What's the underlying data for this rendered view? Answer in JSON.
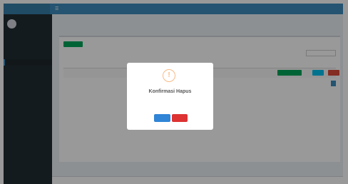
{
  "topbar": {
    "brand": "",
    "toggle_icon": "menu-icon",
    "user": ""
  },
  "sidebar": {
    "user_name": "",
    "user_status": "",
    "items": [
      {
        "label": "",
        "active": false
      },
      {
        "label": "",
        "active": false
      },
      {
        "label": "",
        "active": true
      },
      {
        "label": "",
        "active": false
      }
    ]
  },
  "content": {
    "title": "",
    "add_button": "",
    "show_entries": "",
    "search_label": "",
    "columns": [
      "",
      "",
      "",
      "",
      "",
      "",
      "",
      "",
      "",
      ""
    ],
    "row": [
      "",
      "",
      "",
      "",
      "",
      ""
    ],
    "showing": ""
  },
  "footer": {
    "text": ""
  },
  "modal": {
    "icon": "warning-icon",
    "title": "Konfirmasi Hapus",
    "text": "",
    "confirm_button": "",
    "cancel_button": ""
  },
  "colors": {
    "header": "#3c8dbc",
    "sidebar": "#222d32",
    "success": "#00a65a",
    "info": "#00c0ef",
    "danger": "#dd4b39",
    "confirm": "#3085d6",
    "cancel": "#dd3333",
    "warning_icon": "#f8bb86"
  }
}
